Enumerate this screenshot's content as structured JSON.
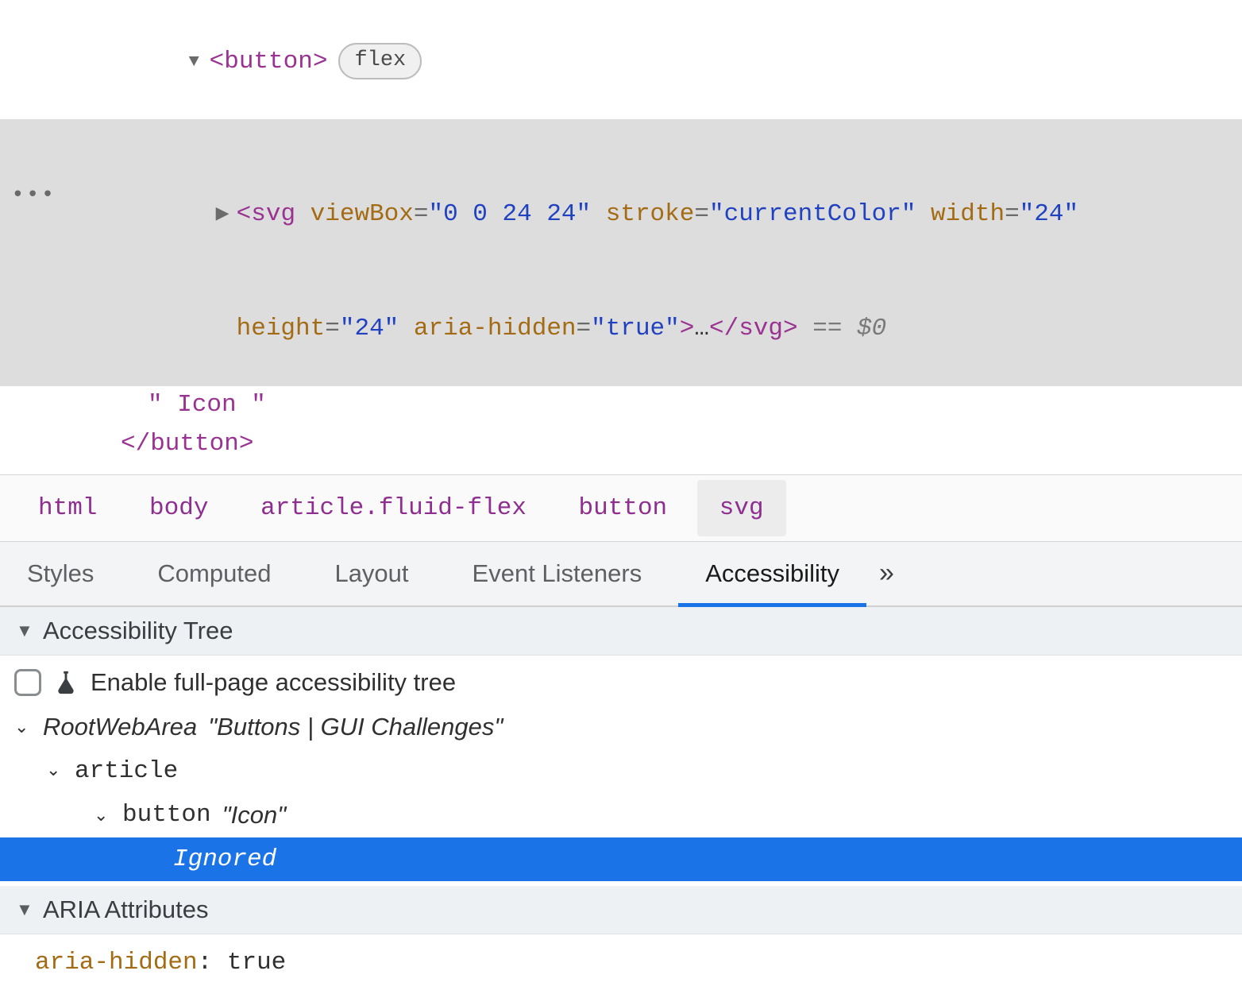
{
  "dom": {
    "button_open": "<button>",
    "flex_badge": "flex",
    "svg_line1_parts": {
      "open": "<",
      "tag": "svg",
      "a1n": "viewBox",
      "a1v": "\"0 0 24 24\"",
      "a2n": "stroke",
      "a2v": "\"currentColor\"",
      "a3n": "width",
      "a3v": "\"24\""
    },
    "svg_line2_parts": {
      "a4n": "height",
      "a4v": "\"24\"",
      "a5n": "aria-hidden",
      "a5v": "\"true\"",
      "close": ">",
      "dots": "…",
      "end": "</svg>",
      "eq0": " == $0"
    },
    "text_node": "\" Icon \"",
    "button_close": "</button>"
  },
  "crumbs": [
    "html",
    "body",
    "article.fluid-flex",
    "button",
    "svg"
  ],
  "tabs": [
    "Styles",
    "Computed",
    "Layout",
    "Event Listeners",
    "Accessibility"
  ],
  "active_tab_index": 4,
  "section_tree": "Accessibility Tree",
  "enable_label": "Enable full-page accessibility tree",
  "tree": {
    "root_kw": "RootWebArea",
    "root_title": "\"Buttons | GUI Challenges\"",
    "article": "article",
    "button_kw": "button",
    "button_title": "\"Icon\"",
    "ignored": "Ignored"
  },
  "section_aria": "ARIA Attributes",
  "aria": {
    "name": "aria-hidden",
    "value": "true"
  }
}
